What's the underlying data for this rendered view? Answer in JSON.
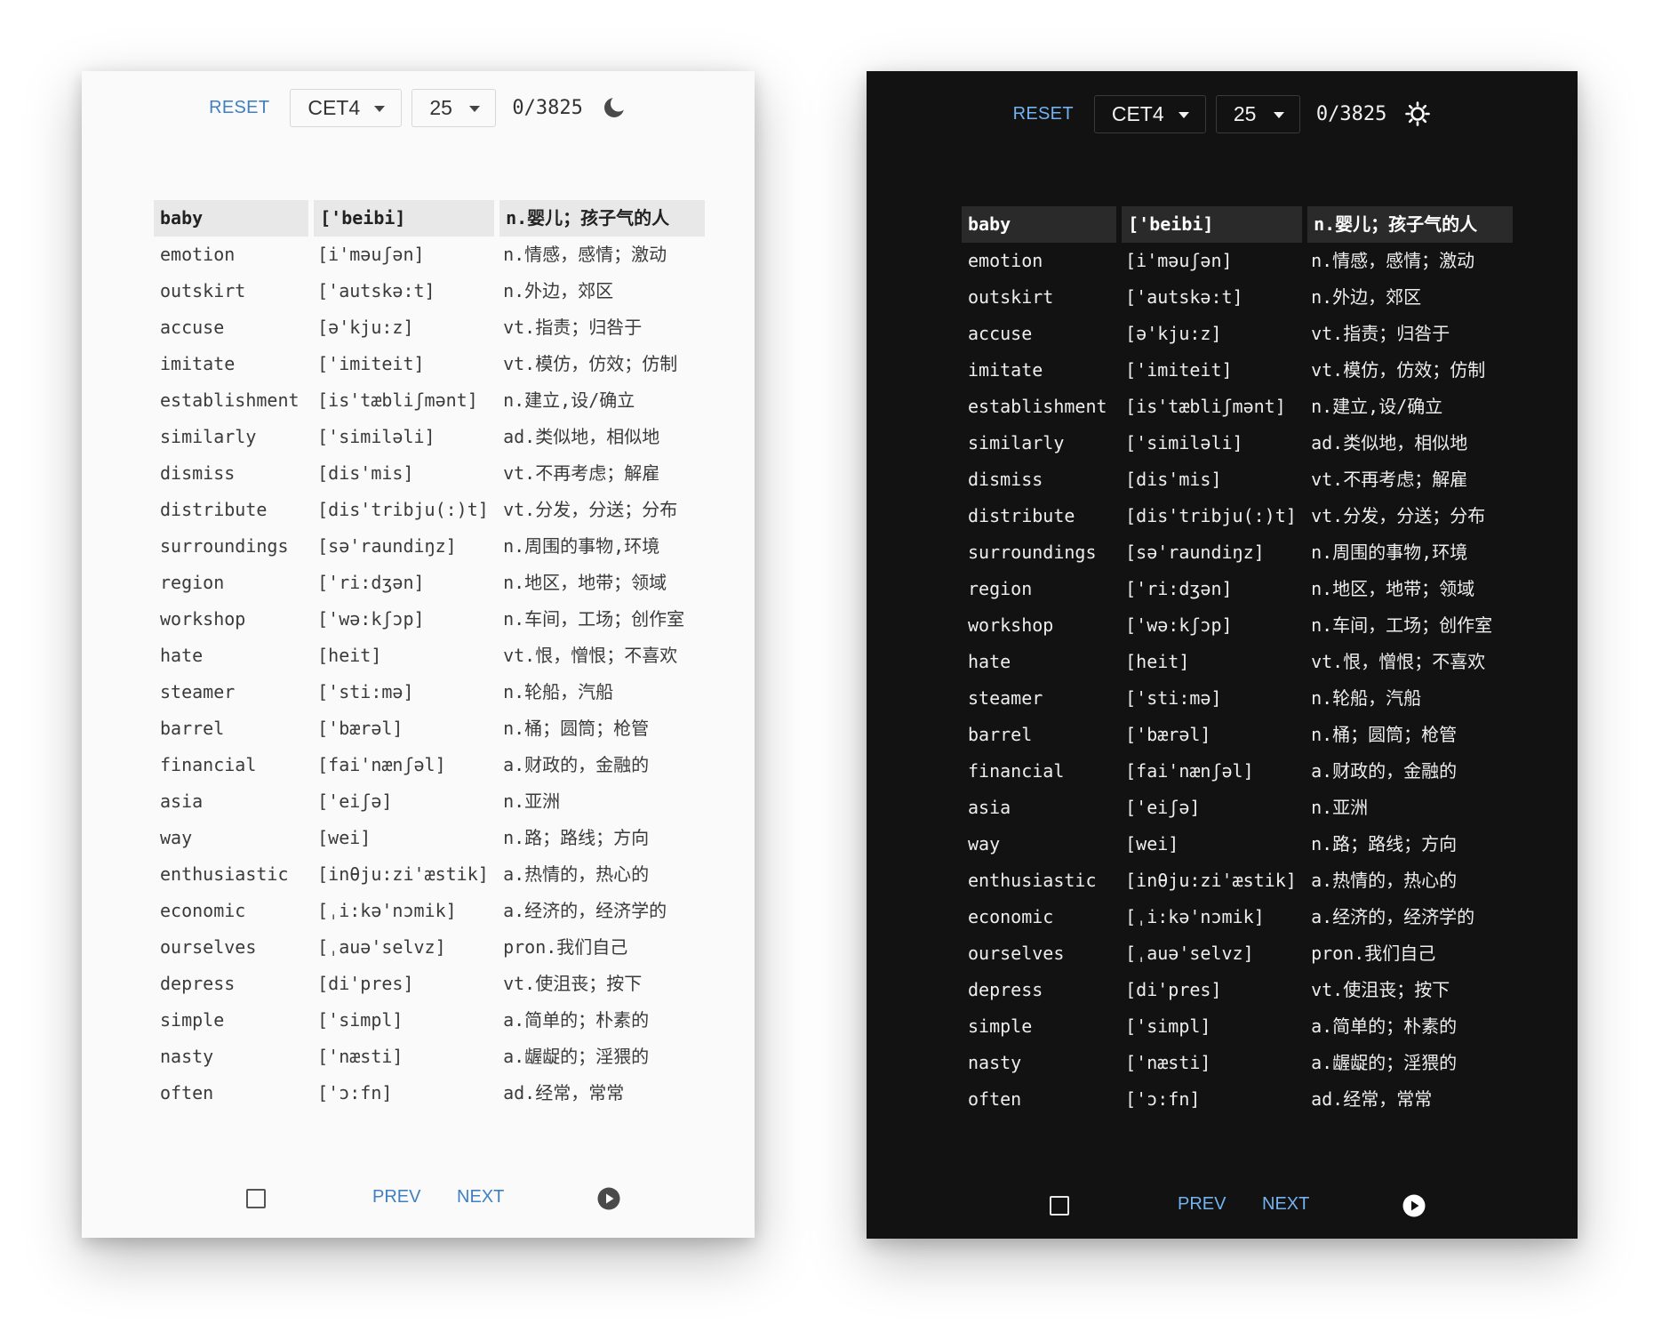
{
  "toolbar": {
    "reset_label": "RESET",
    "book_selected": "CET4",
    "page_size_selected": "25",
    "progress": "0/3825"
  },
  "panels": {
    "light": {
      "theme_icon": "moon-icon"
    },
    "dark": {
      "theme_icon": "sun-icon"
    }
  },
  "footer": {
    "prev_label": "PREV",
    "next_label": "NEXT",
    "checkbox_icon": "checkbox-icon",
    "play_icon": "play-circle-icon"
  },
  "colors": {
    "accent_light": "#3f7fc2",
    "accent_dark": "#74b3f0",
    "light_bg": "#fafafa",
    "dark_bg": "#121212"
  },
  "words": [
    {
      "word": "baby",
      "phonetic": "['beibi]",
      "meaning": "n.婴儿；孩子气的人"
    },
    {
      "word": "emotion",
      "phonetic": "[i'məuʃən]",
      "meaning": "n.情感，感情；激动"
    },
    {
      "word": "outskirt",
      "phonetic": "['autskə:t]",
      "meaning": "n.外边，郊区"
    },
    {
      "word": "accuse",
      "phonetic": "[ə'kju:z]",
      "meaning": "vt.指责；归咎于"
    },
    {
      "word": "imitate",
      "phonetic": "['imiteit]",
      "meaning": "vt.模仿，仿效；仿制"
    },
    {
      "word": "establishment",
      "phonetic": "[is'tæbliʃmənt]",
      "meaning": "n.建立,设/确立"
    },
    {
      "word": "similarly",
      "phonetic": "['similəli]",
      "meaning": "ad.类似地，相似地"
    },
    {
      "word": "dismiss",
      "phonetic": "[dis'mis]",
      "meaning": "vt.不再考虑；解雇"
    },
    {
      "word": "distribute",
      "phonetic": "[dis'tribju(:)t]",
      "meaning": "vt.分发，分送；分布"
    },
    {
      "word": "surroundings",
      "phonetic": "[sə'raundiŋz]",
      "meaning": "n.周围的事物,环境"
    },
    {
      "word": "region",
      "phonetic": "['ri:dʒən]",
      "meaning": "n.地区，地带；领域"
    },
    {
      "word": "workshop",
      "phonetic": "['wə:kʃɔp]",
      "meaning": "n.车间，工场；创作室"
    },
    {
      "word": "hate",
      "phonetic": "[heit]",
      "meaning": "vt.恨，憎恨；不喜欢"
    },
    {
      "word": "steamer",
      "phonetic": "['sti:mə]",
      "meaning": "n.轮船，汽船"
    },
    {
      "word": "barrel",
      "phonetic": "['bærəl]",
      "meaning": "n.桶；圆筒；枪管"
    },
    {
      "word": "financial",
      "phonetic": "[fai'nænʃəl]",
      "meaning": "a.财政的，金融的"
    },
    {
      "word": "asia",
      "phonetic": "['eiʃə]",
      "meaning": "n.亚洲"
    },
    {
      "word": "way",
      "phonetic": "[wei]",
      "meaning": "n.路；路线；方向"
    },
    {
      "word": "enthusiastic",
      "phonetic": "[inθju:zi'æstik]",
      "meaning": "a.热情的，热心的"
    },
    {
      "word": "economic",
      "phonetic": "[ˌi:kə'nɔmik]",
      "meaning": "a.经济的，经济学的"
    },
    {
      "word": "ourselves",
      "phonetic": "[ˌauə'selvz]",
      "meaning": "pron.我们自己"
    },
    {
      "word": "depress",
      "phonetic": "[di'pres]",
      "meaning": "vt.使沮丧；按下"
    },
    {
      "word": "simple",
      "phonetic": "['simpl]",
      "meaning": "a.简单的；朴素的"
    },
    {
      "word": "nasty",
      "phonetic": "['næsti]",
      "meaning": "a.龌龊的；淫猥的"
    },
    {
      "word": "often",
      "phonetic": "['ɔ:fn]",
      "meaning": "ad.经常，常常"
    }
  ]
}
